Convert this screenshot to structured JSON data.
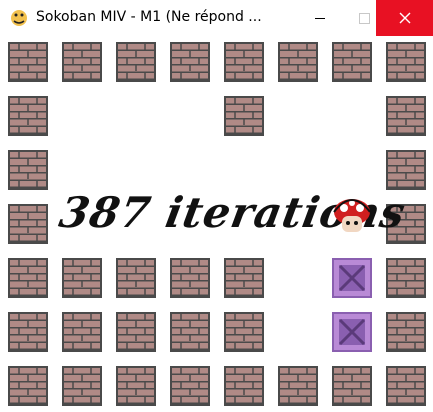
{
  "window": {
    "title": "Sokoban MIV - M1 (Ne répond ...",
    "close_symbol": "✕"
  },
  "icons": {
    "app": "python-snake-icon",
    "minimize": "minimize-icon",
    "maximize": "maximize-icon",
    "close": "close-icon",
    "player": "mushroom-player-icon"
  },
  "colors": {
    "wall_fill": "#b08a86",
    "wall_mortar": "#4a4a4a",
    "box_fill": "#b98ad6",
    "close_button": "#e81123"
  },
  "game": {
    "overlay_text": "387 iterations",
    "grid": [
      "WWWWWWWW",
      "W...W..W",
      "W......W",
      "W......W",
      "WWWWW.BW",
      "WWWWW.BW",
      "WWWWWWWW"
    ]
  }
}
